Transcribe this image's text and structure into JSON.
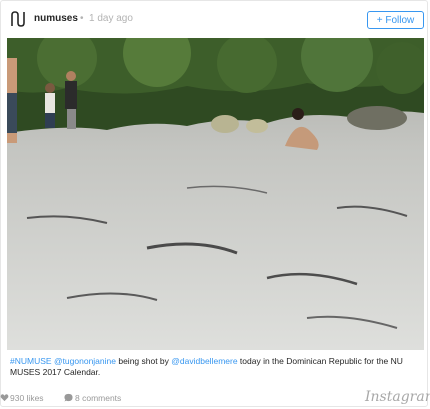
{
  "header": {
    "username": "numuses",
    "separator": "•",
    "timestamp": "1 day ago",
    "follow_label": "+ Follow"
  },
  "caption": {
    "hashtag": "#NUMUSE",
    "mention_1": "@tugononjanine",
    "text_1": " being shot by ",
    "mention_2": "@davidbellemere",
    "text_2": " today in the Dominican Republic for the NU MUSES 2017 Calendar."
  },
  "footer": {
    "likes": "930 likes",
    "comments": "8 comments",
    "brand": "Instagram"
  },
  "colors": {
    "accent": "#3897f0",
    "muted": "#999999"
  }
}
